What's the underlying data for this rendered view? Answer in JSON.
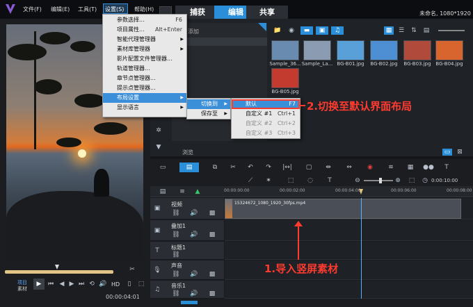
{
  "app": {
    "title_right": "未命名, 1080*1920"
  },
  "menubar": {
    "items": [
      "文件(F)",
      "编辑(E)",
      "工具(T)",
      "设置(S)",
      "帮助(H)"
    ]
  },
  "tabs": [
    "捕获",
    "编辑",
    "共享"
  ],
  "settings_menu": {
    "items": [
      {
        "label": "参数选择...",
        "shortcut": "F6"
      },
      {
        "label": "项目属性...",
        "shortcut": "Alt+Enter"
      },
      {
        "label": "智能代理管理器",
        "shortcut": ""
      },
      {
        "label": "素材库管理器",
        "shortcut": ""
      },
      {
        "label": "影片配置文件管理器...",
        "shortcut": ""
      },
      {
        "label": "轨道管理器...",
        "shortcut": ""
      },
      {
        "label": "章节点管理器...",
        "shortcut": ""
      },
      {
        "label": "提示点管理器...",
        "shortcut": ""
      },
      {
        "label": "布局设置",
        "shortcut": ""
      },
      {
        "label": "显示语言",
        "shortcut": ""
      }
    ]
  },
  "layout_submenu": {
    "items": [
      "切换到",
      "保存至"
    ]
  },
  "switch_submenu": {
    "items": [
      {
        "label": "默认",
        "shortcut": "F7"
      },
      {
        "label": "自定义 #1",
        "shortcut": "Ctrl+1"
      },
      {
        "label": "自定义 #2",
        "shortcut": "Ctrl+2"
      },
      {
        "label": "自定义 #3",
        "shortcut": "Ctrl+3"
      }
    ]
  },
  "annotations": {
    "step2": "2.切换至默认界面布局",
    "step1": "1.导入竖屏素材"
  },
  "library": {
    "add_label": "添加",
    "browse_label": "浏览",
    "thumbnails": [
      {
        "label": "Sample_36...",
        "color": "#6a8bb0"
      },
      {
        "label": "Sample_La...",
        "color": "#8a9bb2"
      },
      {
        "label": "BG-B01.jpg",
        "color": "#5aa0d8"
      },
      {
        "label": "BG-B02.jpg",
        "color": "#4d8fd2"
      },
      {
        "label": "BG-B03.jpg",
        "color": "#b04a3a"
      },
      {
        "label": "BG-B04.jpg",
        "color": "#d9652e"
      },
      {
        "label": "BG-B05.jpg",
        "color": "#c33a2f"
      }
    ]
  },
  "player": {
    "project_label": "项目",
    "clip_label": "素材",
    "hd_label": "HD",
    "timecode": "00:00:04:01"
  },
  "timeline": {
    "ruler": [
      "00:00:00:00",
      "00:00:02:00",
      "00:00:04:00",
      "00:00:06:00",
      "00:00:08:00"
    ],
    "zoom_timecode": "0:00:10:00",
    "tracks": [
      {
        "name": "视频"
      },
      {
        "name": "叠加1"
      },
      {
        "name": "标题1"
      },
      {
        "name": "声音"
      },
      {
        "name": "音乐1"
      }
    ],
    "clip_name": "15324672_1080_1920_30fps.mp4"
  },
  "colors": {
    "accent": "#2a8fd8",
    "annotation_red": "#ff3b30"
  }
}
